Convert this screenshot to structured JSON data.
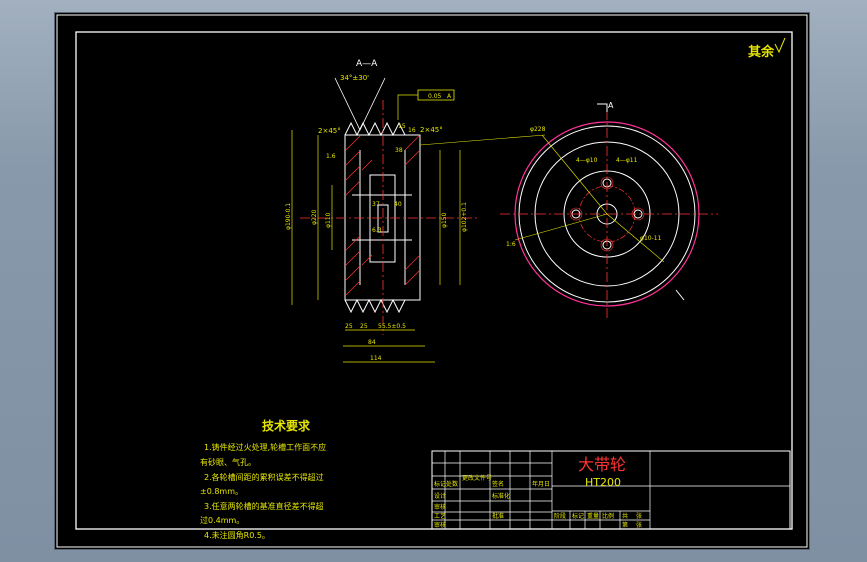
{
  "section_label": "A—A",
  "view_marker": "A",
  "roughness_note": "其余",
  "dimensions": {
    "angle_top": "34°±30'",
    "tol_box": "0.05",
    "tol_ref": "A",
    "chamfer_right": "2×45°",
    "chamfer_left": "2×45°",
    "val_16": "16",
    "val_38": "38",
    "val_15": "15",
    "phi_left": "φ190-0.1",
    "phi_220": "φ220",
    "phi_110": "φ110",
    "phi_right_a": "φ150",
    "phi_right_b": "φ102+0.1",
    "val_37": "37",
    "val_40": "40",
    "val_25": "25",
    "val_25b": "25",
    "val_55": "55.5±0.5",
    "val_84": "84",
    "val_114": "114",
    "r_small": "1.6",
    "r_small2": "6.3",
    "side_phi": "φ228",
    "side_4phi": "4—φ10",
    "side_4phi2": "4—φ11",
    "side_phi_c": "φ10-11",
    "side_r": "1:6"
  },
  "tech_requirements": {
    "title": "技术要求",
    "line1": "1.铸件经过火处理,轮槽工作面不应",
    "line1b": "有砂眼、气孔。",
    "line2": "2.各轮槽间距的累积误差不得超过",
    "line2b": "±0.8mm。",
    "line3": "3.任意两轮槽的基准直径差不得超",
    "line3b": "过0.4mm。",
    "line4": "4.未注圆角R0.5。"
  },
  "title_block": {
    "part_name": "大带轮",
    "material": "HT200",
    "row_labels": [
      "标记",
      "设计",
      "审核",
      "工艺",
      "",
      "审核"
    ],
    "col_labels": [
      "处数",
      "分区",
      "更改文件号",
      "签名",
      "年月日"
    ],
    "mid_labels": [
      "标准化",
      "批准"
    ],
    "stage_labels": [
      "阶段",
      "标记",
      "重量",
      "比例"
    ],
    "sheet_labels": [
      "共",
      "张",
      "第",
      "张"
    ]
  }
}
